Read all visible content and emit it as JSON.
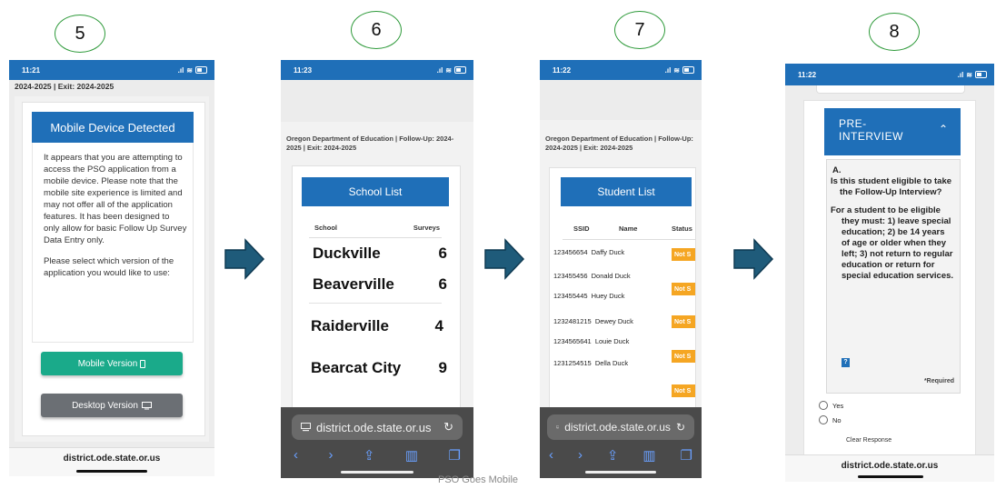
{
  "steps": {
    "s5": "5",
    "s6": "6",
    "s7": "7",
    "s8": "8"
  },
  "footer_caption": "PSO Goes Mobile",
  "phone5": {
    "time": "11:21",
    "subheader": "2024-2025 | Exit: 2024-2025",
    "dialog_title": "Mobile Device Detected",
    "paragraph1": "It appears that you are attempting to access the PSO application from a mobile device. Please note that the mobile site experience is limited and may not offer all of the application features. It has been designed to only allow for basic Follow Up Survey Data Entry only.",
    "paragraph2": "Please select which version of the application you would like to use:",
    "mobile_button": "Mobile Version",
    "desktop_button": "Desktop Version",
    "url": "district.ode.state.or.us",
    "mobile_btn_color": "#1aaa8a",
    "desktop_btn_color": "#6b6f74"
  },
  "phone6": {
    "time": "11:23",
    "org_text": "Oregon Department of Education | Follow-Up: 2024-2025 | Exit: 2024-2025",
    "list_title": "School List",
    "col_school": "School",
    "col_surveys": "Surveys",
    "schools": [
      {
        "name": "Duckville",
        "count": "6"
      },
      {
        "name": "Beaverville",
        "count": "6"
      },
      {
        "name": "Raiderville",
        "count": "4"
      },
      {
        "name": "Bearcat City",
        "count": "9"
      }
    ],
    "url": "district.ode.state.or.us"
  },
  "phone7": {
    "time": "11:22",
    "org_text": "Oregon Department of Education | Follow-Up: 2024-2025 | Exit: 2024-2025",
    "list_title": "Student List",
    "col_ssid": "SSID",
    "col_name": "Name",
    "col_status": "Status",
    "students": [
      {
        "ssid": "123456654",
        "name": "Daffy Duck"
      },
      {
        "ssid": "123455456",
        "name": "Donald Duck"
      },
      {
        "ssid": "123455445",
        "name": "Huey Duck"
      },
      {
        "ssid": "1232481215",
        "name": "Dewey Duck"
      },
      {
        "ssid": "1234565641",
        "name": "Louie Duck"
      },
      {
        "ssid": "1231254515",
        "name": "Della Duck"
      }
    ],
    "status_badge": "Not S",
    "badge_color": "#f5a623",
    "url": "district.ode.state.or.us"
  },
  "phone8": {
    "time": "11:22",
    "section_title": "PRE-INTERVIEW",
    "question_letter": "A.",
    "question_text": "Is this student eligible to take the Follow-Up Interview?",
    "criteria_text": "For a student to be eligible they must: 1) leave special education; 2) be 14 years of age or older when they left; 3) not return to regular education or return for special education services.",
    "help_icon": "?",
    "required_label": "*Required",
    "option_yes": "Yes",
    "option_no": "No",
    "clear_label": "Clear Response",
    "url": "district.ode.state.or.us"
  }
}
